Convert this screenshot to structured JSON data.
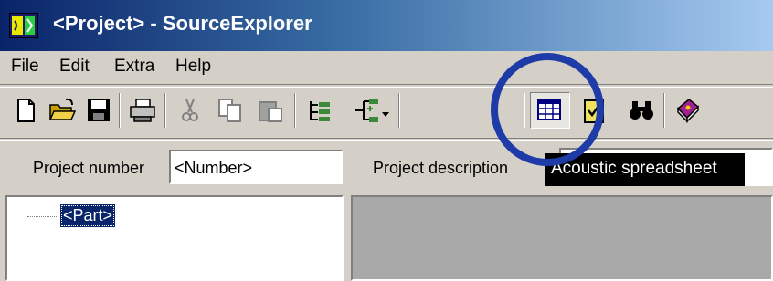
{
  "window": {
    "title": "<Project> - SourceExplorer",
    "icon": "app-icon"
  },
  "menu": {
    "items": [
      "File",
      "Edit",
      "Extra",
      "Help"
    ]
  },
  "toolbar": {
    "buttons": [
      "new-file-icon",
      "open-folder-icon",
      "save-icon",
      "print-icon",
      "cut-icon",
      "copy-icon",
      "paste-icon",
      "tree-add-icon",
      "tree-insert-icon",
      "acoustic-spreadsheet-icon",
      "checklist-icon",
      "find-binoculars-icon",
      "help-book-icon"
    ],
    "pressed": "acoustic-spreadsheet-icon"
  },
  "fields": {
    "project_number_label": "Project number",
    "project_number_value": "<Number>",
    "project_description_label": "Project description"
  },
  "tooltip": {
    "text": "Acoustic spreadsheet"
  },
  "tree": {
    "node_label": "<Part>"
  },
  "colors": {
    "highlight": "#1f3ba8",
    "title_start": "#0a246a",
    "title_end": "#a6caf0"
  }
}
